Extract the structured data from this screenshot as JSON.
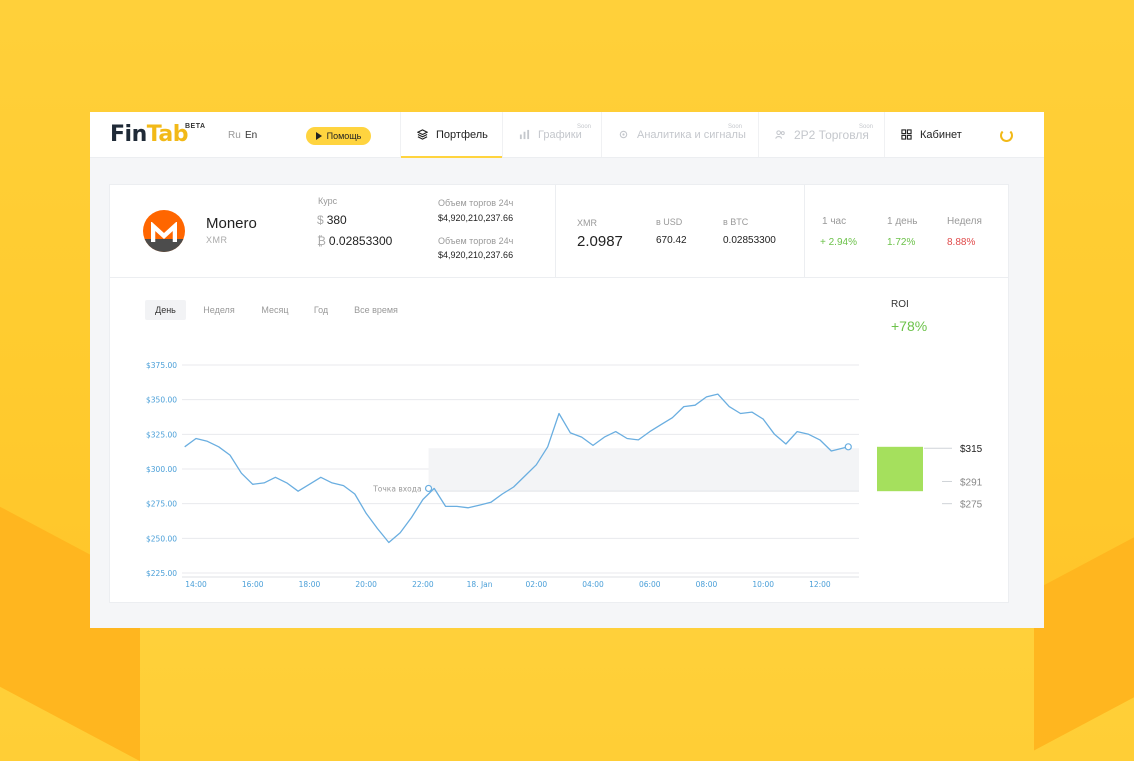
{
  "app": {
    "logo": {
      "fin": "Fin",
      "tab": "Tab",
      "badge": "BETA"
    },
    "lang": {
      "ru": "Ru",
      "en": "En"
    },
    "help_label": "Помощь",
    "nav": [
      {
        "label": "Портфель",
        "soon": "",
        "icon": "layers-icon",
        "active": true
      },
      {
        "label": "Графики",
        "soon": "Soon",
        "icon": "bar-chart-icon"
      },
      {
        "label": "Аналитика и сигналы",
        "soon": "Soon",
        "icon": "gear-icon"
      },
      {
        "label": "2P2 Торговля",
        "soon": "Soon",
        "icon": "users-icon"
      },
      {
        "label": "Кабинет",
        "soon": "",
        "icon": "grid-icon"
      }
    ],
    "refresh_icon": "refresh-icon"
  },
  "coin": {
    "name": "Monero",
    "ticker": "XMR",
    "rate_label": "Курс",
    "usd_symbol": "$",
    "usd_price": "380",
    "btc_symbol": "₿",
    "btc_price": "0.02853300",
    "volume_label_1": "Объем торгов 24ч",
    "volume_value_1": "$4,920,210,237.66",
    "volume_label_2": "Объем торгов 24ч",
    "volume_value_2": "$4,920,210,237.66"
  },
  "holdings": {
    "amount_label": "XMR",
    "amount": "2.0987",
    "usd_label": "в USD",
    "usd_value": "670.42",
    "btc_label": "в BTC",
    "btc_value": "0.02853300"
  },
  "changes": [
    {
      "label": "1 час",
      "value": "+ 2.94%",
      "dir": "up"
    },
    {
      "label": "1 день",
      "value": "1.72%",
      "dir": "up"
    },
    {
      "label": "Неделя",
      "value": "8.88%",
      "dir": "down"
    }
  ],
  "periods": [
    "День",
    "Неделя",
    "Месяц",
    "Год",
    "Все время"
  ],
  "active_period": "День",
  "roi": {
    "label": "ROI",
    "value": "+78%"
  },
  "colors": {
    "accent": "#ffd43f",
    "line": "#6aaee0",
    "gain_bar": "#a5e05d",
    "up": "#6cc24a",
    "down": "#e04a4a"
  },
  "chart_data": {
    "type": "line",
    "y_ticks": [
      "$375.00",
      "$350.00",
      "$325.00",
      "$300.00",
      "$275.00",
      "$250.00",
      "$225.00"
    ],
    "ylim": [
      225,
      375
    ],
    "x_ticks": [
      "14:00",
      "16:00",
      "18:00",
      "20:00",
      "22:00",
      "18. Jan",
      "02:00",
      "04:00",
      "06:00",
      "08:00",
      "10:00",
      "12:00"
    ],
    "x": [
      13.6,
      14.0,
      14.4,
      14.8,
      15.2,
      15.6,
      16.0,
      16.4,
      16.8,
      17.2,
      17.6,
      18.0,
      18.4,
      18.8,
      19.2,
      19.6,
      20.0,
      20.4,
      20.8,
      21.2,
      21.6,
      22.0,
      22.4,
      22.8,
      23.2,
      23.6,
      24.0,
      24.4,
      24.8,
      25.2,
      25.6,
      26.0,
      26.4,
      26.8,
      27.2,
      27.6,
      28.0,
      28.4,
      28.8,
      29.2,
      29.6,
      30.0,
      30.4,
      30.8,
      31.2,
      31.6,
      32.0,
      32.4,
      32.8,
      33.2,
      33.6,
      34.0,
      34.4,
      34.8,
      35.2,
      35.6,
      36.0,
      36.4,
      37.0
    ],
    "y": [
      316,
      322,
      320,
      316,
      310,
      297,
      289,
      290,
      294,
      290,
      284,
      289,
      294,
      290,
      288,
      282,
      268,
      257,
      247,
      254,
      265,
      278,
      286,
      273,
      273,
      272,
      274,
      276,
      282,
      287,
      295,
      303,
      316,
      340,
      326,
      323,
      317,
      323,
      327,
      322,
      321,
      327,
      332,
      337,
      345,
      346,
      352,
      354,
      345,
      340,
      341,
      336,
      325,
      318,
      327,
      325,
      321,
      313,
      316
    ],
    "annotations": [
      {
        "x": 22.2,
        "y": 286,
        "text": "Точка входа"
      }
    ],
    "levels": [
      {
        "label": "$315",
        "value": 315
      },
      {
        "label": "$291",
        "value": 291
      },
      {
        "label": "$275",
        "value": 275
      }
    ],
    "gain_bar": {
      "from": 284,
      "to": 316
    }
  }
}
